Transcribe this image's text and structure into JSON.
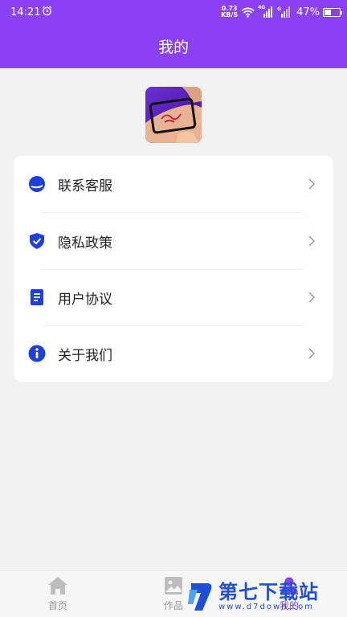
{
  "status_bar": {
    "time": "14:21",
    "net_speed_value": "0.73",
    "net_speed_unit": "KB/S",
    "network_type": "4G",
    "battery_percent": "47%",
    "battery_level": 0.47
  },
  "header": {
    "title": "我的"
  },
  "profile": {
    "avatar_icon": "app-logo-hand-tattoo-image"
  },
  "menu": {
    "items": [
      {
        "label": "联系客服",
        "icon": "headset-icon"
      },
      {
        "label": "隐私政策",
        "icon": "shield-check-icon"
      },
      {
        "label": "用户协议",
        "icon": "document-icon"
      },
      {
        "label": "关于我们",
        "icon": "info-icon"
      }
    ]
  },
  "bottom_nav": {
    "items": [
      {
        "label": "首页",
        "icon": "home-icon"
      },
      {
        "label": "作品",
        "icon": "image-icon"
      },
      {
        "label": "我的",
        "icon": "person-icon"
      }
    ],
    "active_index": 2
  },
  "watermark": {
    "main_text": "第七下载站",
    "sub_text": "www.d7down.com"
  },
  "colors": {
    "brand": "#8a41f5",
    "icon_blue": "#1f3fd9",
    "background": "#f2f2f2"
  }
}
